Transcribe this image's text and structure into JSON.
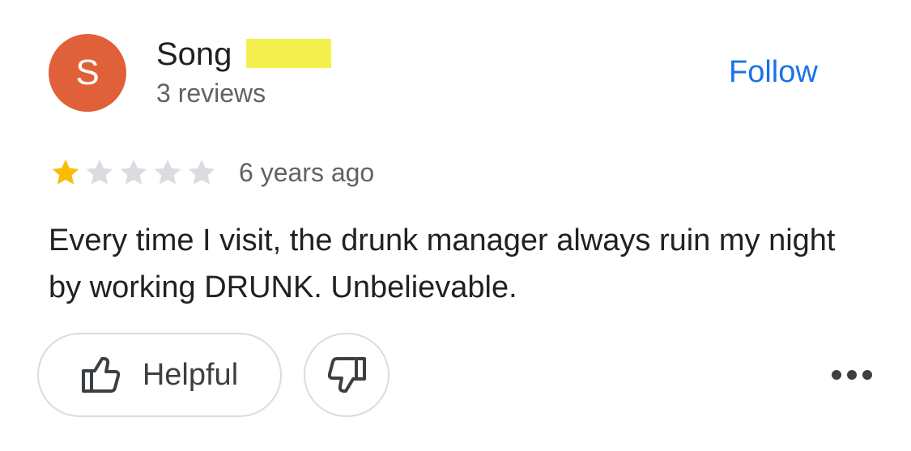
{
  "reviewer": {
    "avatar_letter": "S",
    "name": "Song",
    "review_count": "3 reviews"
  },
  "follow": {
    "label": "Follow"
  },
  "rating": {
    "value": 1,
    "max": 5
  },
  "review": {
    "time": "6 years ago",
    "text": "Every time I visit, the drunk manager always ruin my night by working DRUNK. Unbelievable."
  },
  "actions": {
    "helpful_label": "Helpful",
    "thumbs_up_icon": "thumbs-up-icon",
    "thumbs_down_icon": "thumbs-down-icon",
    "more_icon": "more-horizontal-icon"
  },
  "colors": {
    "avatar_bg": "#e0603a",
    "accent_blue": "#1a73e8",
    "star_filled": "#fbbc04",
    "star_empty": "#dadce0",
    "redaction_yellow": "#f3f04e"
  }
}
